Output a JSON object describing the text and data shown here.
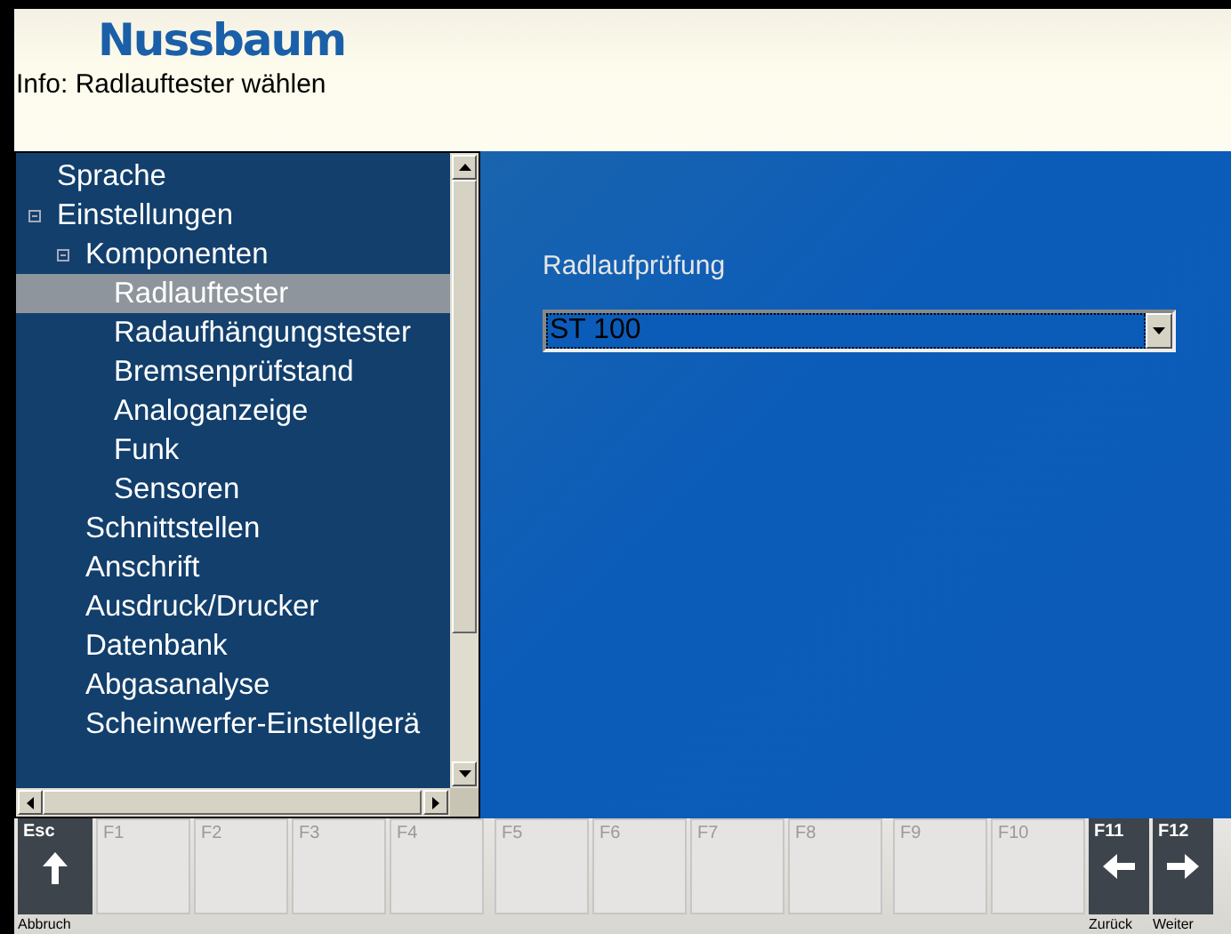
{
  "header": {
    "logo": "Nussbaum",
    "info": "Info: Radlauftester wählen"
  },
  "tree": [
    {
      "label": "Sprache",
      "selected": false
    },
    {
      "label": "Einstellungen",
      "selected": false,
      "expanded": true,
      "children": [
        {
          "label": "Komponenten",
          "selected": false,
          "expanded": true,
          "children": [
            {
              "label": "Radlauftester",
              "selected": true
            },
            {
              "label": "Radaufhängungstester",
              "selected": false
            },
            {
              "label": "Bremsenprüfstand",
              "selected": false
            },
            {
              "label": "Analoganzeige",
              "selected": false
            },
            {
              "label": "Funk",
              "selected": false
            },
            {
              "label": "Sensoren",
              "selected": false
            }
          ]
        },
        {
          "label": "Schnittstellen",
          "selected": false
        },
        {
          "label": "Anschrift",
          "selected": false
        },
        {
          "label": "Ausdruck/Drucker",
          "selected": false
        },
        {
          "label": "Datenbank",
          "selected": false
        },
        {
          "label": "Abgasanalyse",
          "selected": false
        },
        {
          "label": "Scheinwerfer-Einstellgerä",
          "selected": false
        }
      ]
    }
  ],
  "settings": {
    "label": "Radlaufprüfung",
    "value": "ST 100"
  },
  "keys": [
    {
      "key": "Esc",
      "kind": "action",
      "caption": "Abbruch"
    },
    {
      "key": "F1",
      "kind": "empty"
    },
    {
      "key": "F2",
      "kind": "empty"
    },
    {
      "key": "F3",
      "kind": "empty"
    },
    {
      "key": "F4",
      "kind": "empty"
    },
    {
      "key": "F5",
      "kind": "empty"
    },
    {
      "key": "F6",
      "kind": "empty"
    },
    {
      "key": "F7",
      "kind": "empty"
    },
    {
      "key": "F8",
      "kind": "empty"
    },
    {
      "key": "F9",
      "kind": "empty"
    },
    {
      "key": "F10",
      "kind": "empty"
    },
    {
      "key": "F11",
      "kind": "action",
      "caption": "Zurück"
    },
    {
      "key": "F12",
      "kind": "action",
      "caption": "Weiter"
    }
  ]
}
